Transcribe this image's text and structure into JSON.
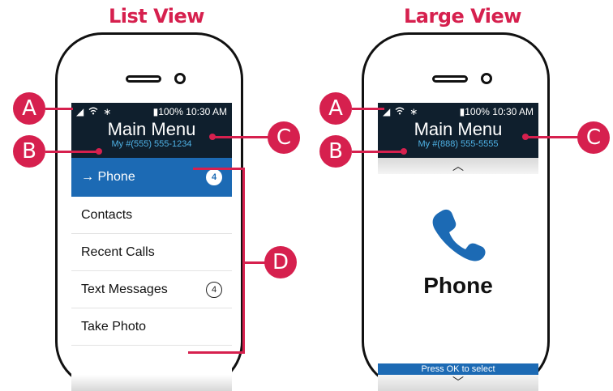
{
  "left": {
    "heading": "List View",
    "status": {
      "battery": "100%",
      "time": "10:30 AM"
    },
    "title": "Main Menu",
    "number": "My #(555) 555-1234",
    "items": [
      {
        "label": "Phone",
        "badge": "4",
        "selected": true
      },
      {
        "label": "Contacts",
        "badge": ""
      },
      {
        "label": "Recent Calls",
        "badge": ""
      },
      {
        "label": "Text Messages",
        "badge": "4"
      },
      {
        "label": "Take Photo",
        "badge": ""
      }
    ],
    "selected_prefix": "→ "
  },
  "right": {
    "heading": "Large View",
    "status": {
      "battery": "100%",
      "time": "10:30 AM"
    },
    "title": "Main Menu",
    "number": "My #(888) 555-5555",
    "item_label": "Phone",
    "ok_text": "Press OK to select"
  },
  "callouts": {
    "a": "A",
    "b": "B",
    "c": "C",
    "d": "D"
  },
  "colors": {
    "accent": "#d6204e",
    "selection": "#1c6ab4",
    "screen_dark": "#0f1f2d",
    "number_text": "#4fb2e6"
  }
}
